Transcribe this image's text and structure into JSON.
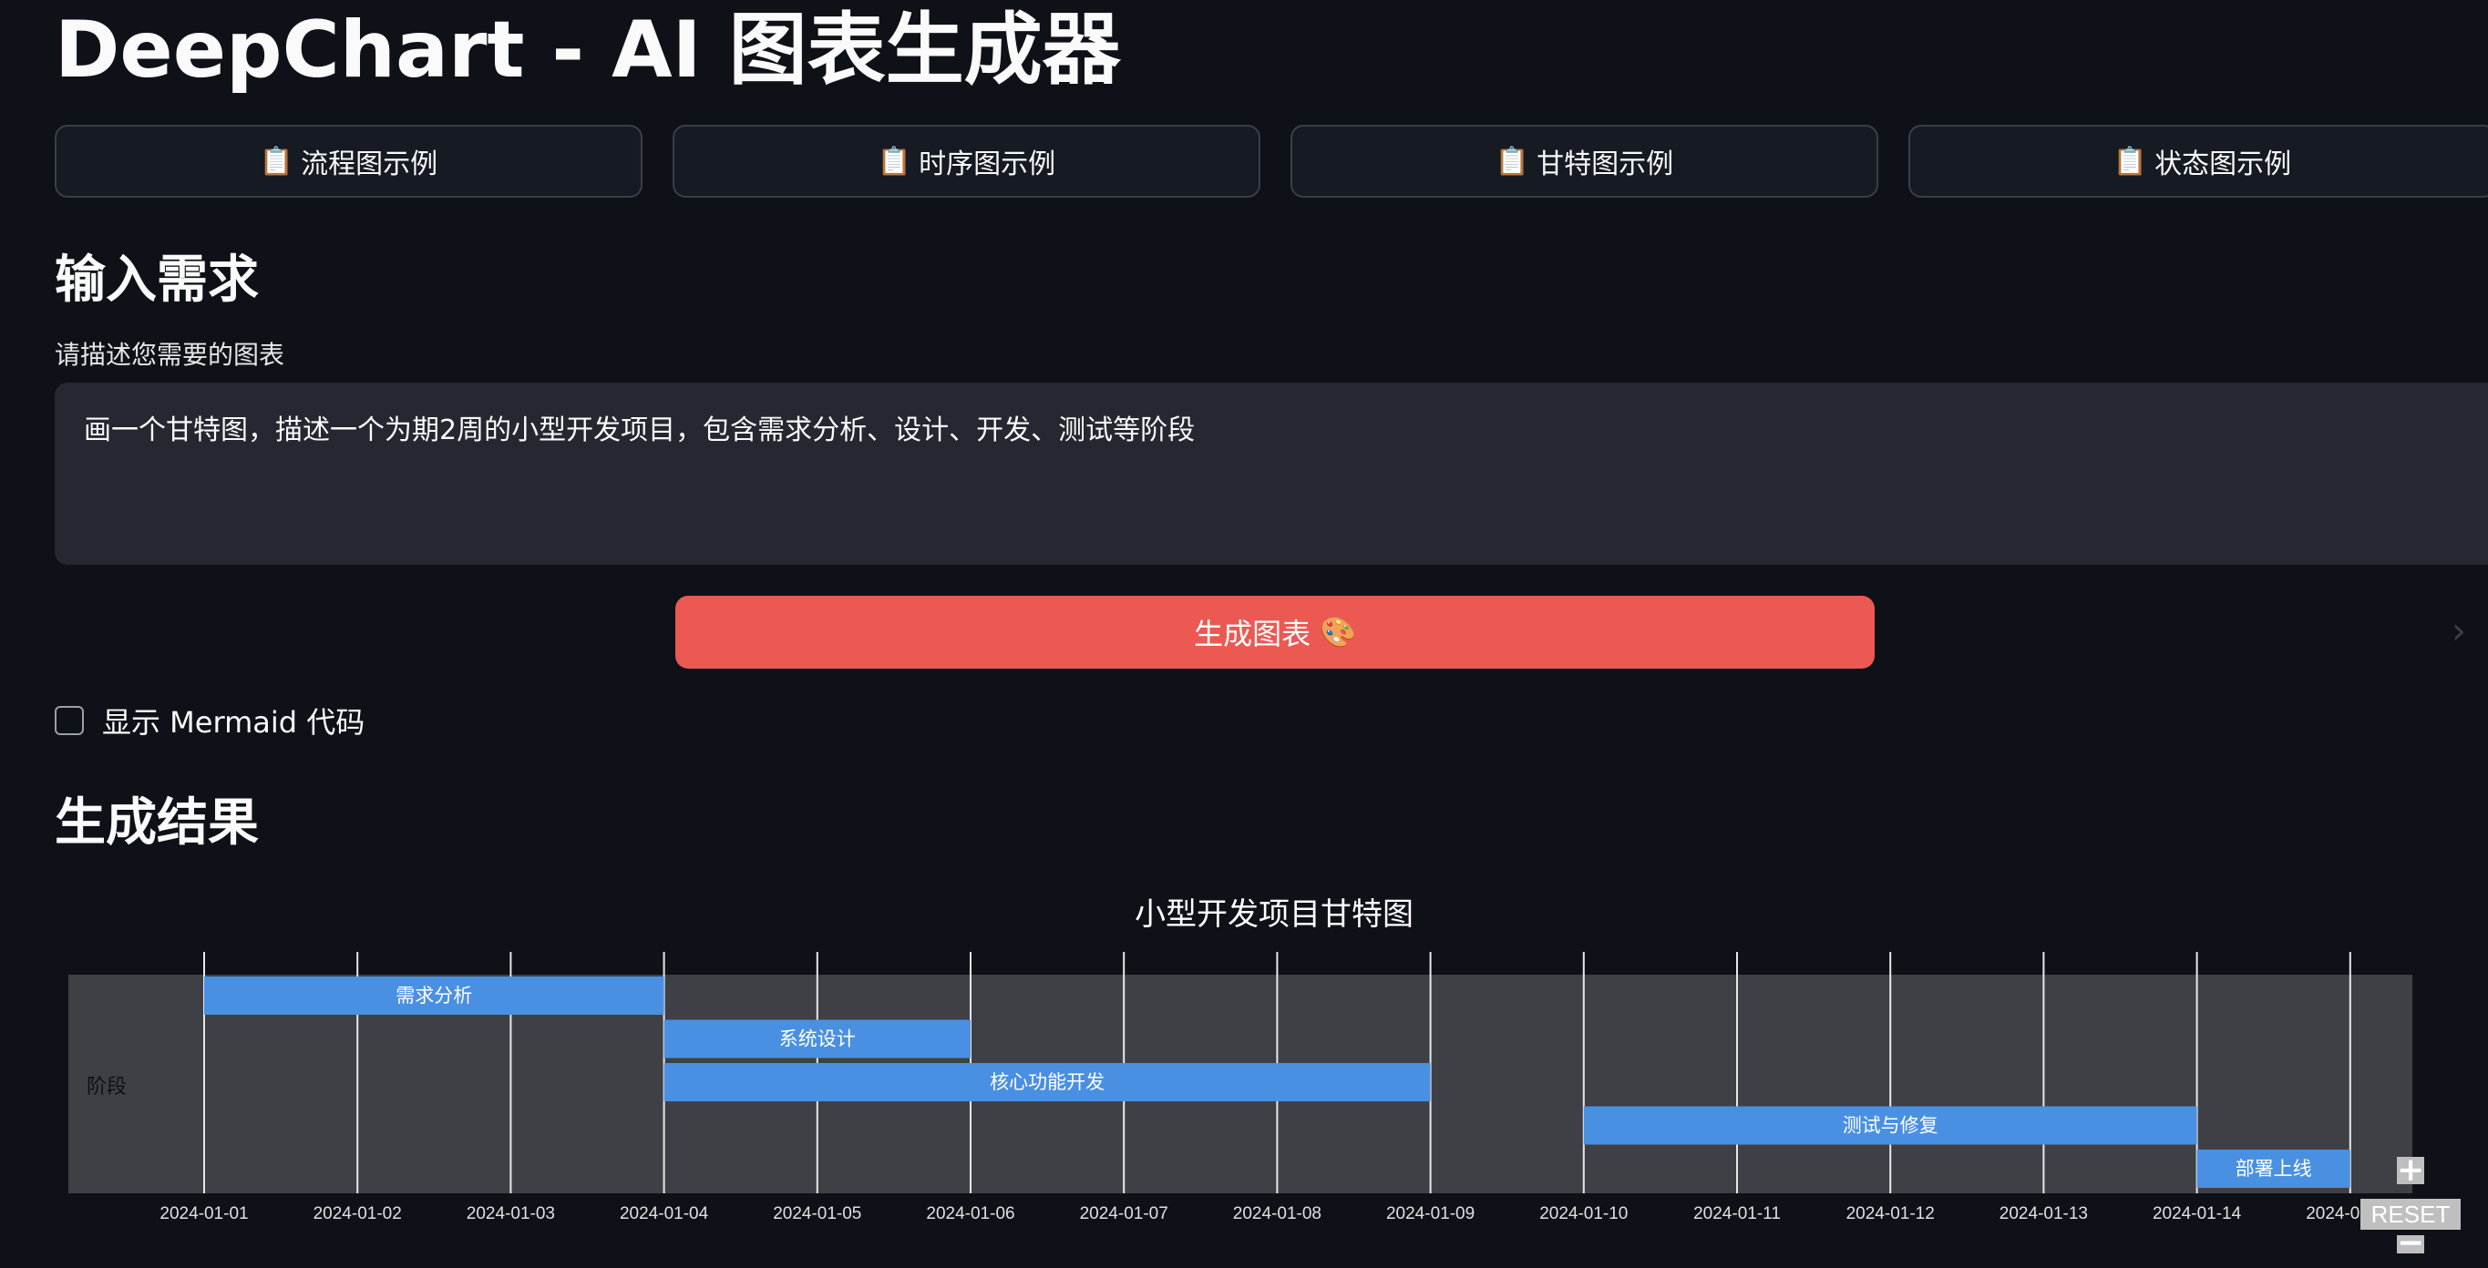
{
  "app": {
    "title": "DeepChart - AI 图表生成器"
  },
  "examples": [
    {
      "icon": "clipboard-icon",
      "label": "流程图示例"
    },
    {
      "icon": "clipboard-icon",
      "label": "时序图示例"
    },
    {
      "icon": "clipboard-icon",
      "label": "甘特图示例"
    },
    {
      "icon": "clipboard-icon",
      "label": "状态图示例"
    }
  ],
  "input_section": {
    "heading": "输入需求",
    "label": "请描述您需要的图表",
    "value": "画一个甘特图，描述一个为期2周的小型开发项目，包含需求分析、设计、开发、测试等阶段"
  },
  "generate_button": {
    "label": "生成图表",
    "icon": "🎨"
  },
  "show_code": {
    "label": "显示 Mermaid 代码",
    "checked": false
  },
  "result_section": {
    "heading": "生成结果"
  },
  "zoom": {
    "plus": "+",
    "reset": "RESET",
    "minus": "−"
  },
  "colors": {
    "accent": "#ec5953",
    "bar": "#4a90e2",
    "background": "#0e1117",
    "plot_bg": "#3f4045"
  },
  "chart_data": {
    "type": "gantt",
    "title": "小型开发项目甘特图",
    "section": "阶段",
    "x_ticks": [
      "2024-01-01",
      "2024-01-02",
      "2024-01-03",
      "2024-01-04",
      "2024-01-05",
      "2024-01-06",
      "2024-01-07",
      "2024-01-08",
      "2024-01-09",
      "2024-01-10",
      "2024-01-11",
      "2024-01-12",
      "2024-01-13",
      "2024-01-14",
      "2024-01-15"
    ],
    "tasks": [
      {
        "name": "需求分析",
        "start": "2024-01-01",
        "end": "2024-01-04"
      },
      {
        "name": "系统设计",
        "start": "2024-01-04",
        "end": "2024-01-06"
      },
      {
        "name": "核心功能开发",
        "start": "2024-01-04",
        "end": "2024-01-09"
      },
      {
        "name": "测试与修复",
        "start": "2024-01-10",
        "end": "2024-01-14"
      },
      {
        "name": "部署上线",
        "start": "2024-01-14",
        "end": "2024-01-15"
      }
    ]
  }
}
